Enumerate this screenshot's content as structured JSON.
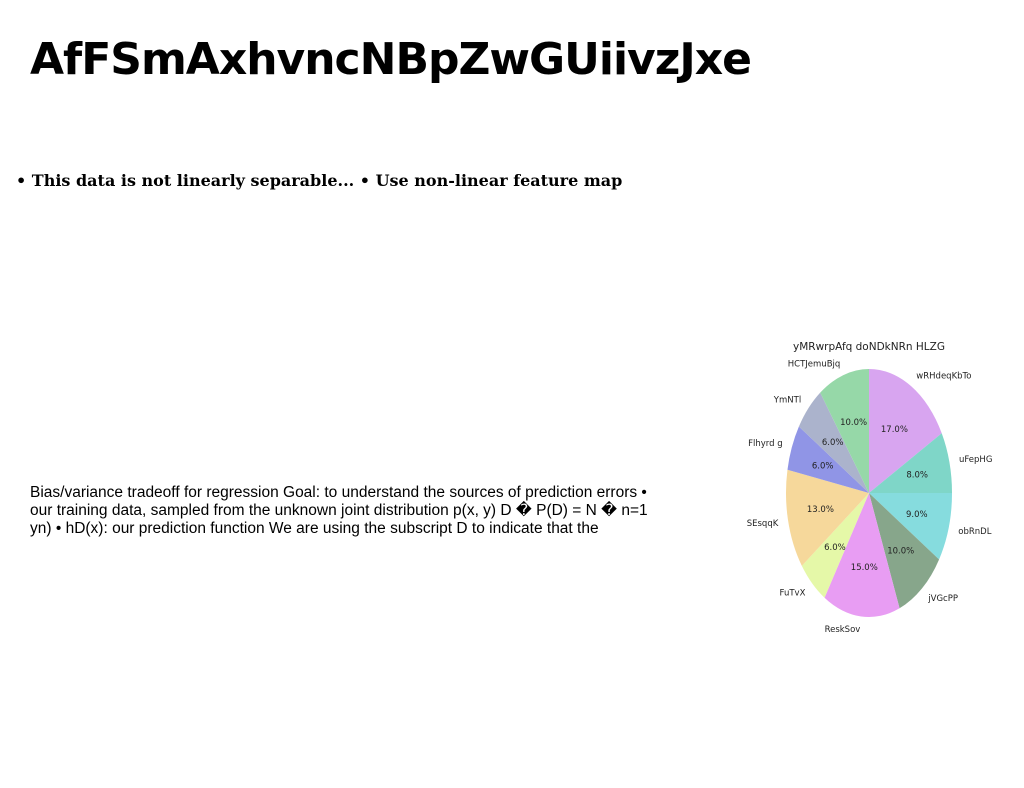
{
  "slide": {
    "title": "AfFSmAxhvncNBpZwGUiivzJxe",
    "bullet_line": "• This data is not linearly separable... • Use non-linear feature map",
    "body_text": "Bias/variance tradeoff for regression Goal: to understand the sources of prediction errors • our training data, sampled from the unknown joint distribution p(x, y) D � P(D) = N � n=1 yn) • hD(x): our prediction function We are using the subscript D to indicate that the"
  },
  "chart_data": {
    "type": "pie",
    "title": "yMRwrpAfq doNDkNRn HLZG",
    "start_angle_deg": 90,
    "direction": "clockwise",
    "slices": [
      {
        "label": "wRHdeqKbTo",
        "value": 17.0,
        "pct_label": "17.0%",
        "color": "#d8a5f0"
      },
      {
        "label": "uFepHG",
        "value": 8.0,
        "pct_label": "8.0%",
        "color": "#7fd6c8"
      },
      {
        "label": "obRnDL",
        "value": 9.0,
        "pct_label": "9.0%",
        "color": "#86dcde"
      },
      {
        "label": "jVGcPP",
        "value": 10.0,
        "pct_label": "10.0%",
        "color": "#87a68b"
      },
      {
        "label": "ReskSov",
        "value": 15.0,
        "pct_label": "15.0%",
        "color": "#e89df3"
      },
      {
        "label": "FuTvX",
        "value": 6.0,
        "pct_label": "6.0%",
        "color": "#e5f8a8"
      },
      {
        "label": "SEsqqK",
        "value": 13.0,
        "pct_label": "13.0%",
        "color": "#f6d89b"
      },
      {
        "label": "Flhyrd g",
        "value": 6.0,
        "pct_label": "6.0%",
        "color": "#9095e6"
      },
      {
        "label": "YmNTl",
        "value": 6.0,
        "pct_label": "6.0%",
        "color": "#abb3cc"
      },
      {
        "label": "HCTJemuBjq",
        "value": 10.0,
        "pct_label": "10.0%",
        "color": "#96d8a8"
      }
    ]
  }
}
